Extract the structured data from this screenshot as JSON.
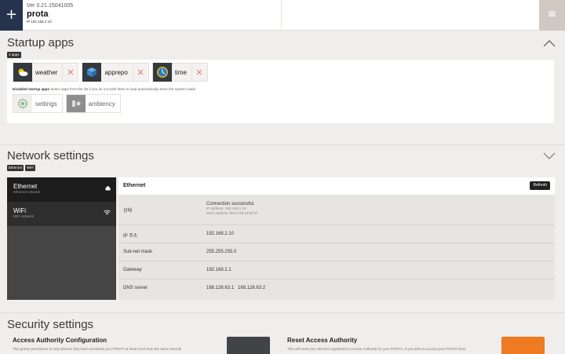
{
  "header": {
    "add_icon": "plus-icon",
    "menu_icon": "hamburger-icon",
    "version": "Ver 0.21.15041005",
    "device_name": "prota",
    "ip": "IP 192.168.2.10"
  },
  "startup": {
    "title": "Startup apps",
    "count_badge": "3 apps",
    "apps": [
      {
        "label": "weather",
        "icon": "weather-icon"
      },
      {
        "label": "apprepo",
        "icon": "apprepo-icon"
      },
      {
        "label": "time",
        "icon": "clock-icon"
      }
    ],
    "disabled_title": "Disabled startup apps",
    "disabled_desc": "Select apps from the list if you do not wish them to load automatically when the system loads.",
    "disabled_apps": [
      {
        "label": "settings",
        "icon": "gear-icon"
      },
      {
        "label": "ambiency",
        "icon": "ambiency-icon"
      }
    ]
  },
  "network": {
    "title": "Network settings",
    "tags": [
      "Ethernet",
      "WiFi"
    ],
    "items": [
      {
        "title": "Ethernet",
        "sub": "Ethernet network",
        "icon": "home-icon"
      },
      {
        "title": "WiFi",
        "sub": "WiFi network",
        "icon": "wifi-icon"
      }
    ],
    "panel_title": "Ethernet",
    "refresh_label": "Refresh",
    "status_label": "상태",
    "status_value": "Connection successful.",
    "status_ip": "IP address: 192.168.2.10",
    "status_mac": "MAC address: b8:27:eb:13:e0:3f",
    "rows": [
      {
        "key": "IP 주소",
        "value": "192.168.2.10"
      },
      {
        "key": "Sub-net mask",
        "value": "255.255.255.0"
      },
      {
        "key": "Gateway",
        "value": "192.168.2.1"
      },
      {
        "key": "DNS server",
        "value": "168.126.63.1   168.126.63.2"
      }
    ]
  },
  "security": {
    "title": "Security settings",
    "access_title": "Access Authority Configuration",
    "access_desc": "This grants permission to only devices that have accessed your PROTA at least once from the same internal",
    "reset_title": "Reset Access Authority",
    "reset_desc": "This will reset your devices registered in Access Authority for your PROTA. If you wish to access your PROTA from",
    "access_btn_color": "#414347",
    "reset_btn_color": "#ee7a22"
  }
}
